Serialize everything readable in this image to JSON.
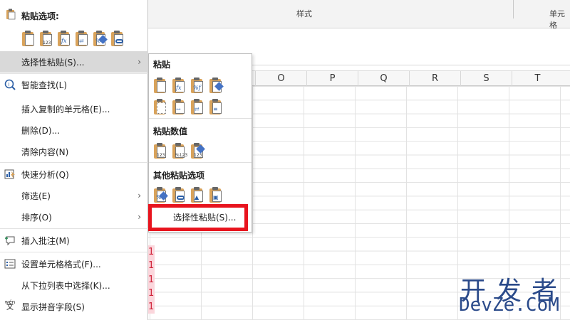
{
  "ribbon": {
    "styles_label": "样式",
    "cells_label": "单元格"
  },
  "columns": [
    "O",
    "P",
    "Q",
    "R",
    "S",
    "T"
  ],
  "row_marks": [
    "1",
    "1",
    "1",
    "1",
    "1"
  ],
  "context_menu": {
    "paste_options_title": "粘贴选项:",
    "paste_icons": [
      "paste-icon",
      "paste-values-icon",
      "paste-formulas-icon",
      "paste-transpose-icon",
      "paste-formatting-icon",
      "paste-link-icon"
    ],
    "items": [
      {
        "label": "选择性粘贴(S)...",
        "icon": "",
        "submenu": true,
        "highlighted": true
      },
      {
        "label": "智能查找(L)",
        "icon": "smart-lookup-icon",
        "submenu": false
      },
      {
        "label": "插入复制的单元格(E)...",
        "icon": "",
        "submenu": false
      },
      {
        "label": "删除(D)...",
        "icon": "",
        "submenu": false
      },
      {
        "label": "清除内容(N)",
        "icon": "",
        "submenu": false
      },
      {
        "label": "快速分析(Q)",
        "icon": "quick-analysis-icon",
        "submenu": false
      },
      {
        "label": "筛选(E)",
        "icon": "",
        "submenu": true
      },
      {
        "label": "排序(O)",
        "icon": "",
        "submenu": true
      },
      {
        "label": "插入批注(M)",
        "icon": "comment-icon",
        "submenu": false
      },
      {
        "label": "设置单元格格式(F)...",
        "icon": "format-cells-icon",
        "submenu": false
      },
      {
        "label": "从下拉列表中选择(K)...",
        "icon": "",
        "submenu": false
      },
      {
        "label": "显示拼音字段(S)",
        "icon": "phonetic-icon",
        "submenu": false
      }
    ],
    "phonetic_icon_text": "wén"
  },
  "submenu": {
    "paste_title": "粘贴",
    "paste_values_title": "粘贴数值",
    "other_title": "其他粘贴选项",
    "special_paste_label": "选择性粘贴(S)..."
  },
  "watermark": {
    "line1": "开发者",
    "line2": "DevZe.CoM"
  },
  "colors": {
    "highlight_box": "#e8141e",
    "menu_hover": "#d9d9d9",
    "clipboard": "#d9a35b"
  }
}
